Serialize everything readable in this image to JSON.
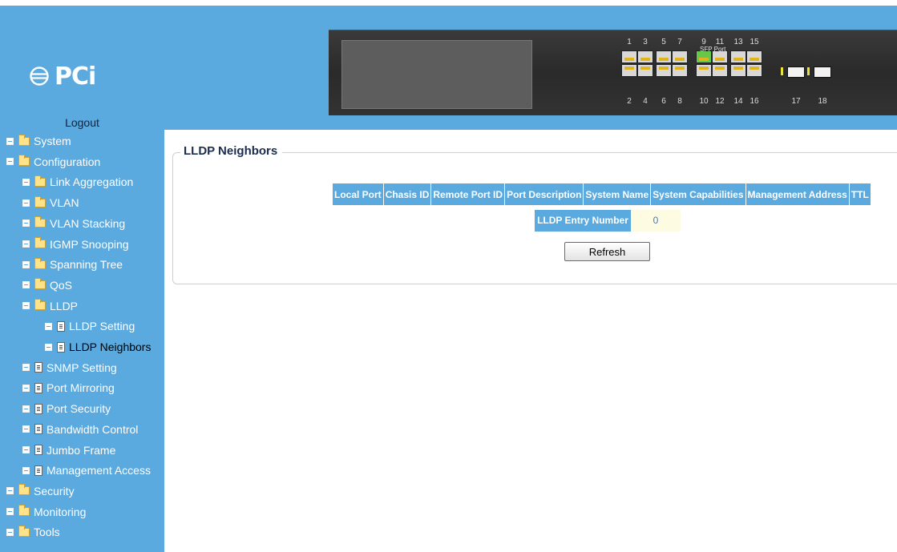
{
  "header": {
    "logo_text": "PCi",
    "logout_label": "Logout"
  },
  "switch_panel": {
    "top_ports": [
      "1",
      "3",
      "5",
      "7",
      "9",
      "11",
      "13",
      "15"
    ],
    "bottom_ports": [
      "2",
      "4",
      "6",
      "8",
      "10",
      "12",
      "14",
      "16"
    ],
    "sfp_label": "SFP Port",
    "sfp_ports": [
      "17",
      "18"
    ],
    "active_port": "9"
  },
  "sidebar": {
    "items": [
      {
        "label": "System"
      },
      {
        "label": "Configuration"
      },
      {
        "label": "Link Aggregation"
      },
      {
        "label": "VLAN"
      },
      {
        "label": "VLAN Stacking"
      },
      {
        "label": "IGMP Snooping"
      },
      {
        "label": "Spanning Tree"
      },
      {
        "label": "QoS"
      },
      {
        "label": "LLDP"
      },
      {
        "label": "LLDP Setting"
      },
      {
        "label": "LLDP Neighbors"
      },
      {
        "label": "SNMP Setting"
      },
      {
        "label": "Port Mirroring"
      },
      {
        "label": "Port Security"
      },
      {
        "label": "Bandwidth Control"
      },
      {
        "label": "Jumbo Frame"
      },
      {
        "label": "Management Access"
      },
      {
        "label": "Security"
      },
      {
        "label": "Monitoring"
      },
      {
        "label": "Tools"
      }
    ]
  },
  "main": {
    "section_title": "LLDP Neighbors",
    "table_headers": [
      "Local Port",
      "Chasis ID",
      "Remote Port ID",
      "Port Description",
      "System Name",
      "System Capabilities",
      "Management Address",
      "TTL"
    ],
    "entry_label": "LLDP Entry Number",
    "entry_value": "0",
    "refresh_label": "Refresh"
  },
  "colors": {
    "accent": "#5aa9df",
    "active_port": "#66c84a",
    "entry_value_bg": "#fdfbe1"
  }
}
